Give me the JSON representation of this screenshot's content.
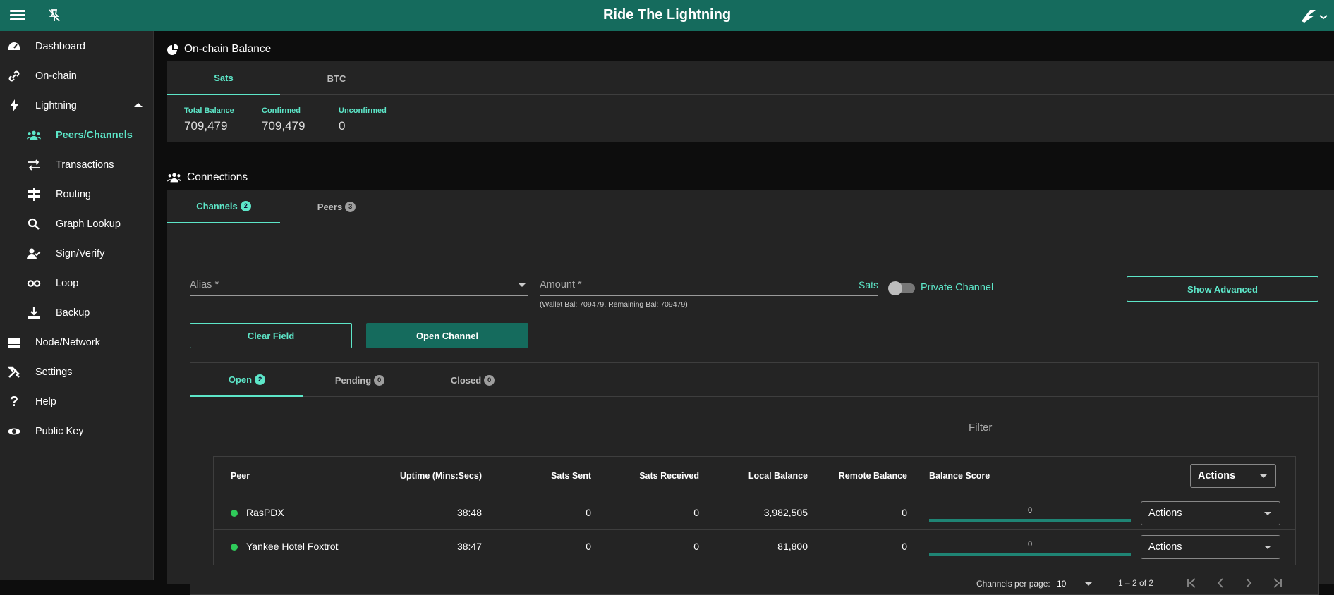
{
  "app": {
    "title": "Ride The Lightning"
  },
  "sidebar": {
    "items": [
      {
        "label": "Dashboard",
        "icon": "dashboard-icon"
      },
      {
        "label": "On-chain",
        "icon": "link-icon"
      },
      {
        "label": "Lightning",
        "icon": "bolt-icon"
      },
      {
        "label": "Peers/Channels",
        "icon": "users-icon"
      },
      {
        "label": "Transactions",
        "icon": "exchange-icon"
      },
      {
        "label": "Routing",
        "icon": "signpost-icon"
      },
      {
        "label": "Graph Lookup",
        "icon": "search-icon"
      },
      {
        "label": "Sign/Verify",
        "icon": "user-check-icon"
      },
      {
        "label": "Loop",
        "icon": "infinity-icon"
      },
      {
        "label": "Backup",
        "icon": "download-icon"
      },
      {
        "label": "Node/Network",
        "icon": "server-icon"
      },
      {
        "label": "Settings",
        "icon": "tools-icon"
      },
      {
        "label": "Help",
        "icon": "question-icon"
      },
      {
        "label": "Public Key",
        "icon": "eye-icon"
      }
    ]
  },
  "onchain": {
    "title": "On-chain Balance",
    "tabs": [
      "Sats",
      "BTC"
    ],
    "total_label": "Total Balance",
    "total_value": "709,479",
    "confirmed_label": "Confirmed",
    "confirmed_value": "709,479",
    "unconfirmed_label": "Unconfirmed",
    "unconfirmed_value": "0"
  },
  "connections": {
    "title": "Connections",
    "tabs": [
      {
        "label": "Channels",
        "count": "2"
      },
      {
        "label": "Peers",
        "count": "3"
      }
    ],
    "form": {
      "alias_placeholder": "Alias *",
      "amount_placeholder": "Amount *",
      "amount_unit": "Sats",
      "wallet_hint": "(Wallet Bal: 709479, Remaining Bal: 709479)",
      "private_label": "Private Channel",
      "show_advanced": "Show Advanced",
      "clear": "Clear Field",
      "open": "Open Channel"
    },
    "channel_tabs": [
      {
        "label": "Open",
        "count": "2"
      },
      {
        "label": "Pending",
        "count": "0"
      },
      {
        "label": "Closed",
        "count": "0"
      }
    ],
    "filter_placeholder": "Filter",
    "table": {
      "headers": {
        "peer": "Peer",
        "uptime": "Uptime (Mins:Secs)",
        "sent": "Sats Sent",
        "received": "Sats Received",
        "local": "Local Balance",
        "remote": "Remote Balance",
        "score": "Balance Score",
        "actions": "Actions"
      },
      "rows": [
        {
          "peer": "RasPDX",
          "uptime": "38:48",
          "sent": "0",
          "received": "0",
          "local": "3,982,505",
          "remote": "0",
          "score": "0",
          "actions": "Actions"
        },
        {
          "peer": "Yankee Hotel Foxtrot",
          "uptime": "38:47",
          "sent": "0",
          "received": "0",
          "local": "81,800",
          "remote": "0",
          "score": "0",
          "actions": "Actions"
        }
      ]
    },
    "paginator": {
      "per_page_label": "Channels per page:",
      "per_page_value": "10",
      "range": "1 – 2 of 2"
    }
  },
  "colors": {
    "accent": "#5de6c8",
    "primary": "#156b5d",
    "online": "#2fcb5a"
  }
}
